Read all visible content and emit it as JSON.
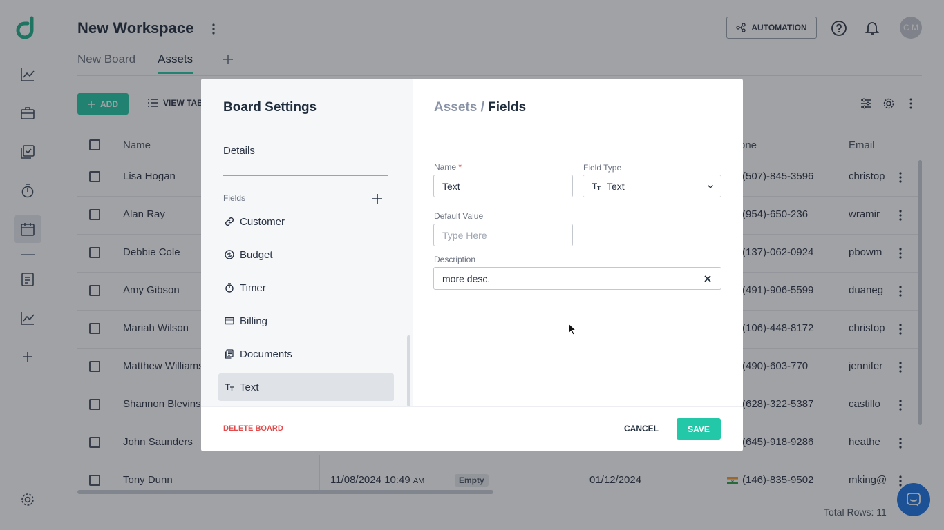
{
  "workspace": {
    "title": "New Workspace"
  },
  "tabs": [
    {
      "label": "New Board"
    },
    {
      "label": "Assets"
    }
  ],
  "header": {
    "automation_label": "AUTOMATION",
    "avatar_initials": "C M"
  },
  "toolbar": {
    "add_label": "ADD",
    "view_label": "VIEW TAB"
  },
  "grid": {
    "columns": [
      "Name",
      "one",
      "Email"
    ],
    "rows": [
      {
        "name": "Lisa Hogan",
        "phone": "(507)-845-3596",
        "email": "christop"
      },
      {
        "name": "Alan Ray",
        "phone": "(954)-650-236",
        "email": "wramir"
      },
      {
        "name": "Debbie Cole",
        "phone": "(137)-062-0924",
        "email": "pbowm"
      },
      {
        "name": "Amy Gibson",
        "phone": "(491)-906-5599",
        "email": "duaneg"
      },
      {
        "name": "Mariah Wilson",
        "phone": "(106)-448-8172",
        "email": "christop"
      },
      {
        "name": "Matthew Williams",
        "phone": "(490)-603-770",
        "email": "jennifer"
      },
      {
        "name": "Shannon Blevins",
        "phone": "(628)-322-5387",
        "email": "castillo"
      },
      {
        "name": "John Saunders",
        "phone": "(645)-918-9286",
        "email": "heathe"
      },
      {
        "name": "Tony Dunn",
        "datetime": "11/08/2024 10:49",
        "ampm": "AM",
        "status": "Empty",
        "date": "01/12/2024",
        "phone": "(146)-835-9502",
        "email": "mking@"
      }
    ],
    "total_rows": "Total Rows: 11"
  },
  "modal": {
    "title": "Board Settings",
    "details_label": "Details",
    "fields_label": "Fields",
    "field_items": [
      {
        "label": "Customer",
        "icon": "link-icon"
      },
      {
        "label": "Budget",
        "icon": "dollar-icon"
      },
      {
        "label": "Timer",
        "icon": "timer-icon"
      },
      {
        "label": "Billing",
        "icon": "card-icon"
      },
      {
        "label": "Documents",
        "icon": "documents-icon"
      },
      {
        "label": "Text",
        "icon": "text-type-icon"
      }
    ],
    "breadcrumb": {
      "parent": "Assets",
      "separator": " / ",
      "current": "Fields"
    },
    "form": {
      "name_label": "Name",
      "required_mark": "*",
      "name_value": "Text",
      "field_type_label": "Field Type",
      "field_type_value": "Text",
      "default_value_label": "Default Value",
      "default_value_placeholder": "Type Here",
      "description_label": "Description",
      "description_value": "more desc."
    },
    "delete_label": "DELETE BOARD",
    "cancel_label": "CANCEL",
    "save_label": "SAVE"
  },
  "colors": {
    "accent": "#23c8a8",
    "danger": "#e24b4b",
    "chat": "#1b74e4"
  }
}
